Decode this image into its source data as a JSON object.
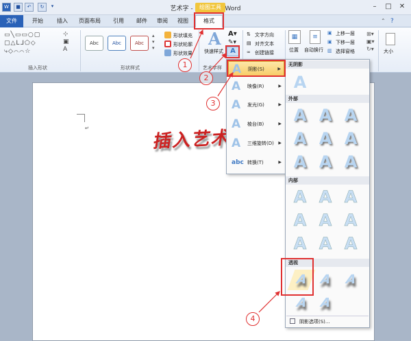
{
  "window": {
    "title": "艺术字 - Microsoft Word",
    "context_tab": "绘图工具"
  },
  "tabs": {
    "file": "文件",
    "items": [
      "开始",
      "插入",
      "页面布局",
      "引用",
      "邮件",
      "审阅",
      "视图"
    ],
    "format": "格式"
  },
  "ribbon": {
    "insert_shapes_group": "插入形状",
    "shape_styles_group": "形状样式",
    "style_swatch": "Abc",
    "shape_fill": "形状填充",
    "shape_outline": "形状轮廓",
    "shape_effects": "形状效果",
    "quick_styles": "快速样式",
    "wordart_group_partial": "艺术字样",
    "text_direction": "文字方向",
    "align_text": "对齐文本",
    "create_link": "创建链接",
    "position": "位置",
    "auto_wrap": "自动换行",
    "bring_forward": "上移一层",
    "send_backward": "下移一层",
    "selection_pane": "选择窗格",
    "size": "大小"
  },
  "document": {
    "wordart_text": "插入艺术"
  },
  "effects_menu": {
    "items": [
      {
        "label": "阴影(S)",
        "glyph": "A"
      },
      {
        "label": "映像(R)",
        "glyph": "A"
      },
      {
        "label": "发光(G)",
        "glyph": "A"
      },
      {
        "label": "棱台(B)",
        "glyph": "A"
      },
      {
        "label": "三维旋转(D)",
        "glyph": "A"
      },
      {
        "label": "转换(T)",
        "glyph": "abc"
      }
    ]
  },
  "shadow_gallery": {
    "sections": {
      "none": "无阴影",
      "outer": "外部",
      "inner": "内部",
      "perspective": "透视"
    },
    "glyph": "A",
    "options_link": "阴影选项(S)..."
  },
  "annotations": [
    "1",
    "2",
    "3",
    "4"
  ],
  "colors": {
    "highlight": "#e03030",
    "file_tab": "#2a62b8",
    "context_tab": "#f1c63d"
  }
}
